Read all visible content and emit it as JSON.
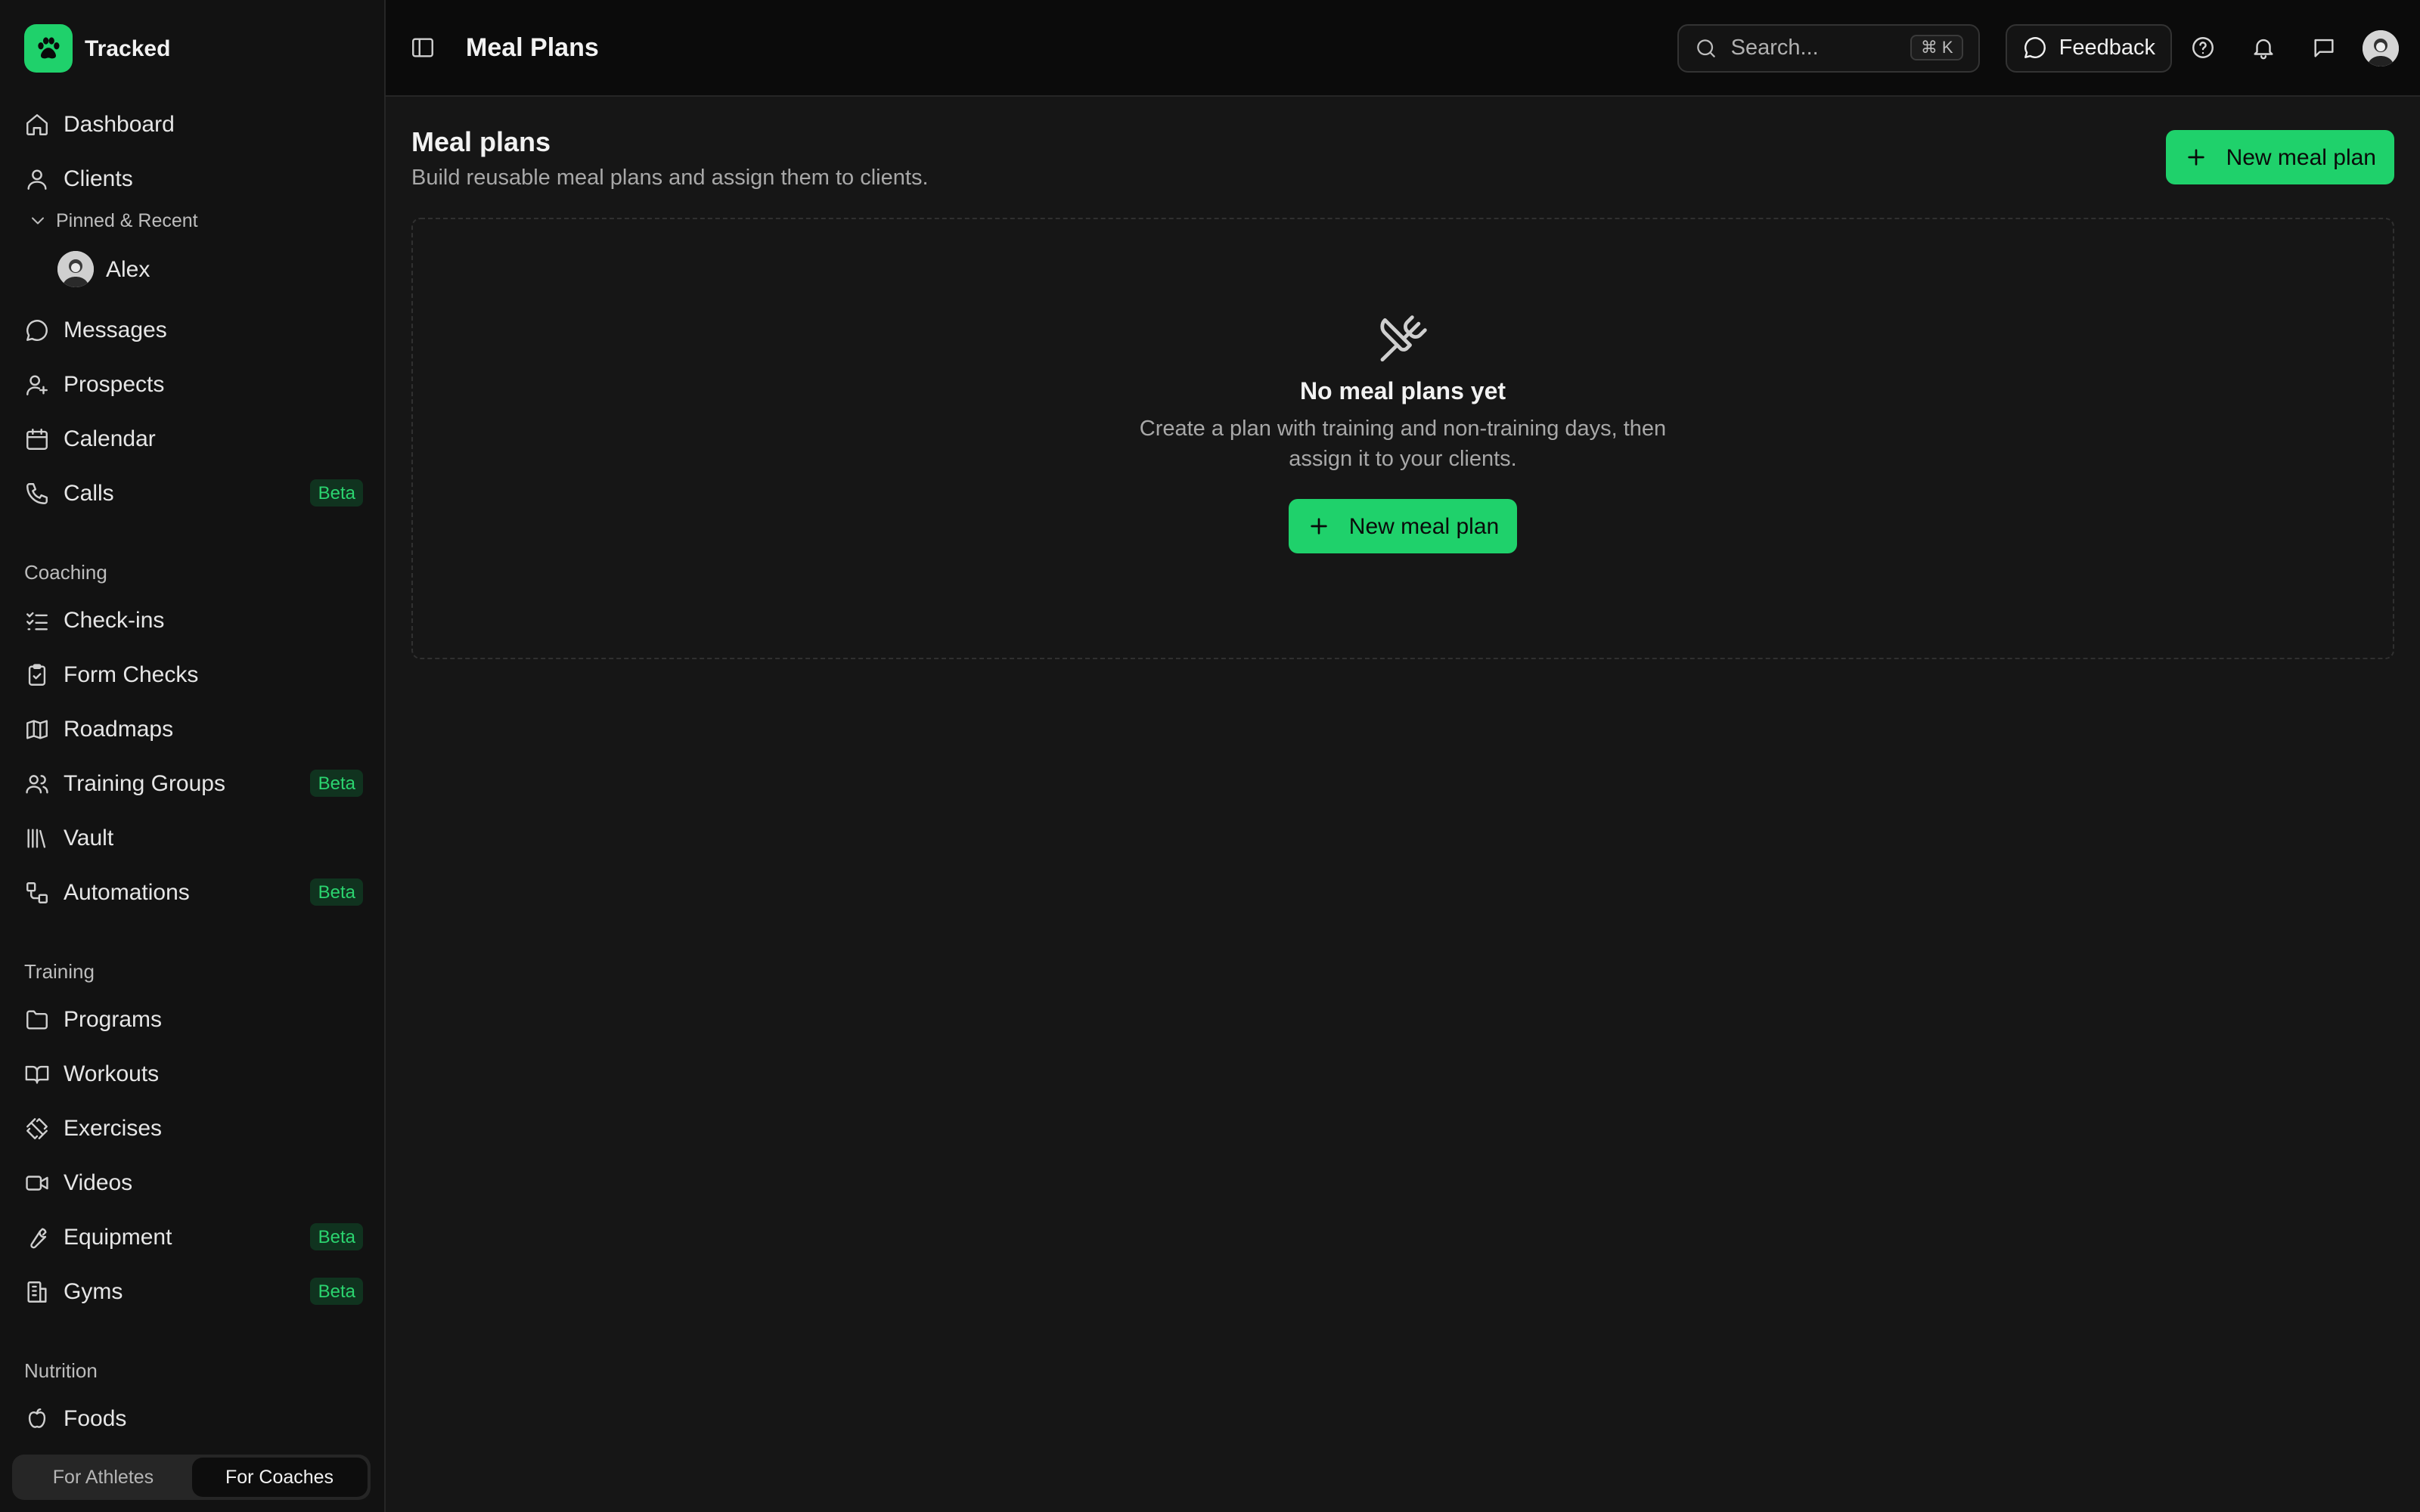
{
  "brand": {
    "name": "Tracked"
  },
  "sidebar": {
    "main_items": [
      {
        "label": "Dashboard"
      },
      {
        "label": "Clients"
      }
    ],
    "pinned_header": "Pinned & Recent",
    "pinned": [
      {
        "label": "Alex"
      }
    ],
    "items2": [
      {
        "label": "Messages"
      },
      {
        "label": "Prospects"
      },
      {
        "label": "Calendar"
      },
      {
        "label": "Calls",
        "badge": "Beta"
      }
    ],
    "coaching_label": "Coaching",
    "coaching": [
      {
        "label": "Check-ins"
      },
      {
        "label": "Form Checks"
      },
      {
        "label": "Roadmaps"
      },
      {
        "label": "Training Groups",
        "badge": "Beta"
      },
      {
        "label": "Vault"
      },
      {
        "label": "Automations",
        "badge": "Beta"
      }
    ],
    "training_label": "Training",
    "training": [
      {
        "label": "Programs"
      },
      {
        "label": "Workouts"
      },
      {
        "label": "Exercises"
      },
      {
        "label": "Videos"
      },
      {
        "label": "Equipment",
        "badge": "Beta"
      },
      {
        "label": "Gyms",
        "badge": "Beta"
      }
    ],
    "nutrition_label": "Nutrition",
    "nutrition": [
      {
        "label": "Foods"
      }
    ],
    "toggle": {
      "athletes": "For Athletes",
      "coaches": "For Coaches",
      "active": "coaches"
    }
  },
  "topbar": {
    "title": "Meal Plans",
    "search_placeholder": "Search...",
    "search_shortcut": "⌘ K",
    "feedback_label": "Feedback"
  },
  "main": {
    "heading": "Meal plans",
    "subheading": "Build reusable meal plans and assign them to clients.",
    "new_button": "New meal plan",
    "empty": {
      "title": "No meal plans yet",
      "description": "Create a plan with training and non-training days, then assign it to your clients.",
      "button": "New meal plan"
    }
  },
  "colors": {
    "accent": "#1fd16b",
    "background": "#161616",
    "sidebar": "#121212"
  }
}
